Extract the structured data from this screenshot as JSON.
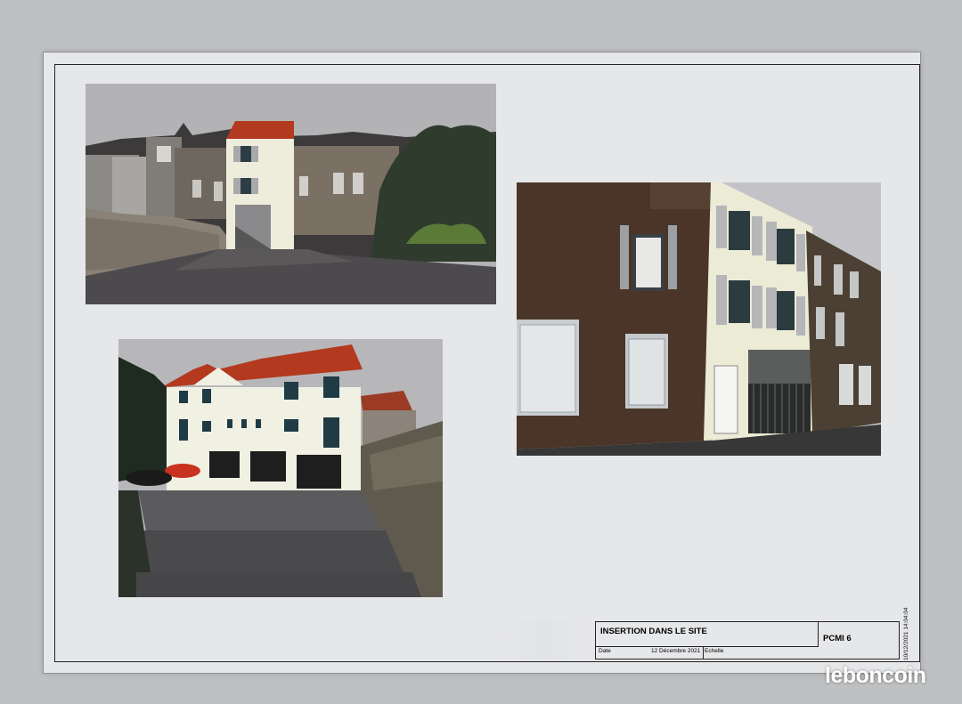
{
  "cartouche": {
    "title": "INSERTION DANS LE SITE",
    "reference": "PCMI 6",
    "date_label": "Date",
    "date_value": "12 Décembre 2021",
    "scale_label": "Echelle"
  },
  "stamp_text": "10/12/2021 14:04:04",
  "watermark": "leboncoin",
  "colors": {
    "roof": "#b3391f",
    "facade": "#eeeddc",
    "sky": "#b7b7b9",
    "asphalt": "#505052"
  }
}
